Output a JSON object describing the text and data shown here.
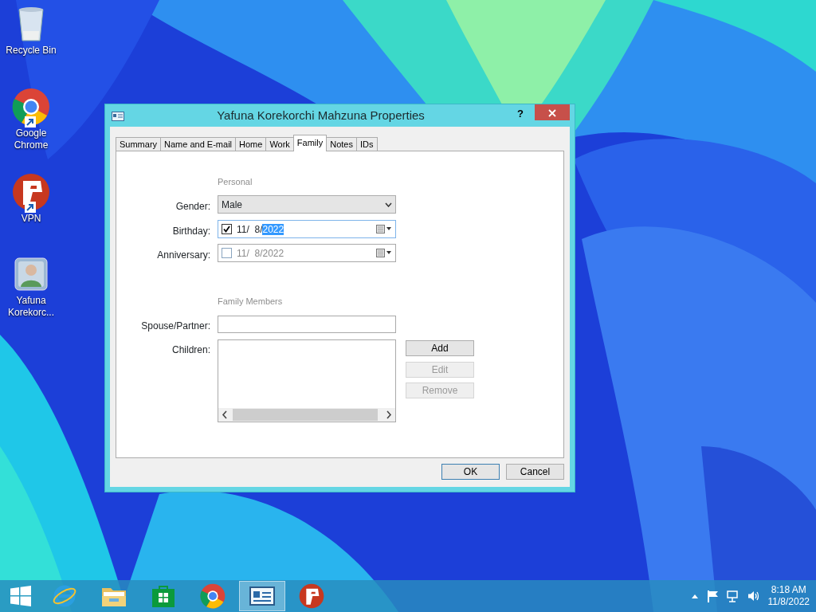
{
  "desktop_icons": [
    {
      "kind": "bin",
      "label": "Recycle Bin",
      "shortcut": false
    },
    {
      "kind": "chrome",
      "label": "Google Chrome",
      "shortcut": true
    },
    {
      "kind": "vpn",
      "label": "VPN",
      "shortcut": true
    },
    {
      "kind": "contact",
      "label": "Yafuna Korekorc...",
      "shortcut": false
    }
  ],
  "dialog": {
    "title": "Yafuna Korekorchi Mahzuna Properties",
    "help": "?",
    "tabs": [
      {
        "label": "Summary",
        "selected": false
      },
      {
        "label": "Name and E-mail",
        "selected": false
      },
      {
        "label": "Home",
        "selected": false
      },
      {
        "label": "Work",
        "selected": false
      },
      {
        "label": "Family",
        "selected": true
      },
      {
        "label": "Notes",
        "selected": false
      },
      {
        "label": "IDs",
        "selected": false
      }
    ],
    "personal": {
      "heading": "Personal",
      "gender": {
        "label": "Gender:",
        "value": "Male"
      },
      "birthday": {
        "label": "Birthday:",
        "checked": true,
        "segments": [
          {
            "text": "11/  8/",
            "selected": false
          },
          {
            "text": "2022",
            "selected": true
          }
        ]
      },
      "anniversary": {
        "label": "Anniversary:",
        "checked": false,
        "segments": [
          {
            "text": "11/  8/2022",
            "selected": false
          }
        ]
      }
    },
    "family_members": {
      "heading": "Family Members",
      "spouse": {
        "label": "Spouse/Partner:"
      },
      "children": {
        "label": "Children:"
      },
      "buttons": [
        {
          "label": "Add",
          "disabled": false
        },
        {
          "label": "Edit",
          "disabled": true
        },
        {
          "label": "Remove",
          "disabled": true
        }
      ]
    },
    "footer_buttons": [
      {
        "label": "OK",
        "default": true
      },
      {
        "label": "Cancel",
        "default": false
      }
    ]
  },
  "taskbar": {
    "items": [
      {
        "kind": "ie",
        "active": false
      },
      {
        "kind": "explorer",
        "active": false
      },
      {
        "kind": "store",
        "active": false
      },
      {
        "kind": "chrome",
        "active": false
      },
      {
        "kind": "contact",
        "active": true
      },
      {
        "kind": "vpn",
        "active": false
      }
    ],
    "clock": {
      "time": "8:18 AM",
      "date": "11/8/2022"
    }
  }
}
